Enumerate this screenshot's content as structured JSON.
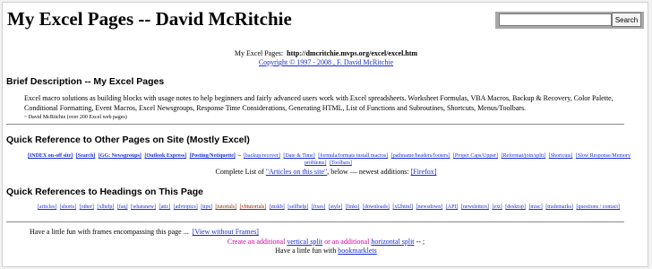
{
  "title": "My Excel Pages -- David McRitchie",
  "search": {
    "placeholder": "",
    "button": "Search"
  },
  "header": {
    "url_label": "My Excel Pages:",
    "url": "http://dmcritchie.mvps.org/excel/excel.htm",
    "copyright": "Copyright © 1997 - 2008 , F. David McRitchie"
  },
  "brief": {
    "heading": "Brief Description -- My Excel Pages",
    "text": "Excel macro solutions as building blocks with usage notes to help beginners and fairly advanced users work with Excel spreadsheets. Worksheet Formulas, VBA Macros, Backup & Recovery, Color Palette, Conditional Formatting, Event Macros, Excel Newsgroups, Response Time Considerations, Generating HTML, List of Functions and Subroutines, Shortcuts, Menus/Toolbars.",
    "byline": "~ David McRitchie (over 200 Excel web pages)"
  },
  "quickref": {
    "heading": "Quick Reference to Other Pages on Site (Mostly Excel)",
    "links_bold": [
      "[INDEX on-off site]",
      "[Search]",
      "[GG: Newsgroups]",
      "[Outlook Express]",
      "[Posting/Netiquette]"
    ],
    "links": [
      "[backup/recover]",
      "[Date & Time]",
      "[formula/formats install macros]",
      "[pathname/headers/footers]",
      "[Proper Caps/Upper]",
      "[Reformat/join/split]",
      "[Shortcuts]",
      "[Slow Response/Memory problems]",
      "[Toolbars]"
    ],
    "complete_text": "Complete List of",
    "complete_link": "\"Articles on this site\"",
    "newest_text": ", below — newest additions:",
    "newest_link": "[Firefox]"
  },
  "headings": {
    "heading": "Quick References to Headings on This Page",
    "links": [
      "[articles]",
      "[shorts]",
      "[other]",
      "[xlhelp]",
      "[faq]",
      "[whatsnew]",
      "[attc]",
      "[advtopics]",
      "[tips]",
      "[tutorials]",
      "[vbtutorials]",
      "[mskb]",
      "[selfhelp]",
      "[fixes]",
      "[style]",
      "[links]",
      "[downloads]",
      "[xl2html]",
      "[newsdown]",
      "[API]",
      "[newsletters]",
      "[ext]",
      "[desktop]",
      "[misc]",
      "[trademarks]",
      "[questions / contact]"
    ]
  },
  "frames": {
    "text": "Have a little fun with frames encompassing this page ...",
    "link": "[View without Frames]",
    "create_text": "Create an additional",
    "vertical_link": "vertical split",
    "or_text": "or an additional",
    "horizontal_link": "horizontal split",
    "end_text": "-- ;",
    "fun_text": "Have a little fun with",
    "bookmarklets": "bookmarklets"
  },
  "colors": {
    "link": "#1a2fd0",
    "background": "#ffffff",
    "outer": "#f2f2f2",
    "search_bar": "#a8a8a8"
  }
}
